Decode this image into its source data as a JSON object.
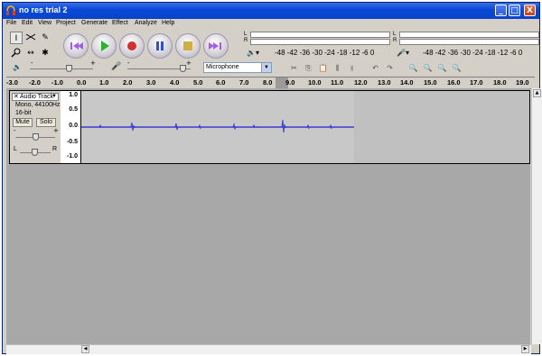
{
  "window": {
    "title": "no res trial 2",
    "minimize": "_",
    "maximize": "□",
    "close": "X"
  },
  "menu": [
    "File",
    "Edit",
    "View",
    "Project",
    "Generate",
    "Effect",
    "Analyze",
    "Help"
  ],
  "meters": {
    "scale": "-48  -42  -36  -30  -24  -18  -12   -6    0",
    "left_label": "L",
    "right_label": "R"
  },
  "mixer": {
    "input_source": "Microphone",
    "dropdown_glyph": "▼"
  },
  "ruler": {
    "ticks": [
      "-3.0",
      "-2.0",
      "-1.0",
      "0.0",
      "1.0",
      "2.0",
      "3.0",
      "4.0",
      "5.0",
      "6.0",
      "7.0",
      "8.0",
      "9.0",
      "10.0",
      "11.0",
      "12.0",
      "13.0",
      "14.0",
      "15.0",
      "16.0",
      "17.0",
      "18.0",
      "19.0"
    ]
  },
  "track": {
    "close": "✕",
    "name": "Audio Track",
    "name_arrow": "▼",
    "info1": "Mono, 44100Hz",
    "info2": "16-bit",
    "mute": "Mute",
    "solo": "Solo",
    "gain_minus": "-",
    "gain_plus": "+",
    "pan_left": "L",
    "pan_right": "R",
    "vruler": [
      "1.0",
      "0.5",
      "0.0",
      "-0.5",
      "-1.0"
    ]
  },
  "colors": {
    "waveform": "#3a3ad0",
    "titlebar": "#0b4ad8",
    "track_bg": "#a8a8a8"
  },
  "icons": {
    "tools": [
      "selection-tool-icon",
      "envelope-tool-icon",
      "draw-tool-icon",
      "zoom-tool-icon",
      "timeshift-tool-icon",
      "multi-tool-icon"
    ],
    "transport": [
      "skip-start-icon",
      "play-icon",
      "record-icon",
      "pause-icon",
      "stop-icon",
      "skip-end-icon"
    ]
  }
}
